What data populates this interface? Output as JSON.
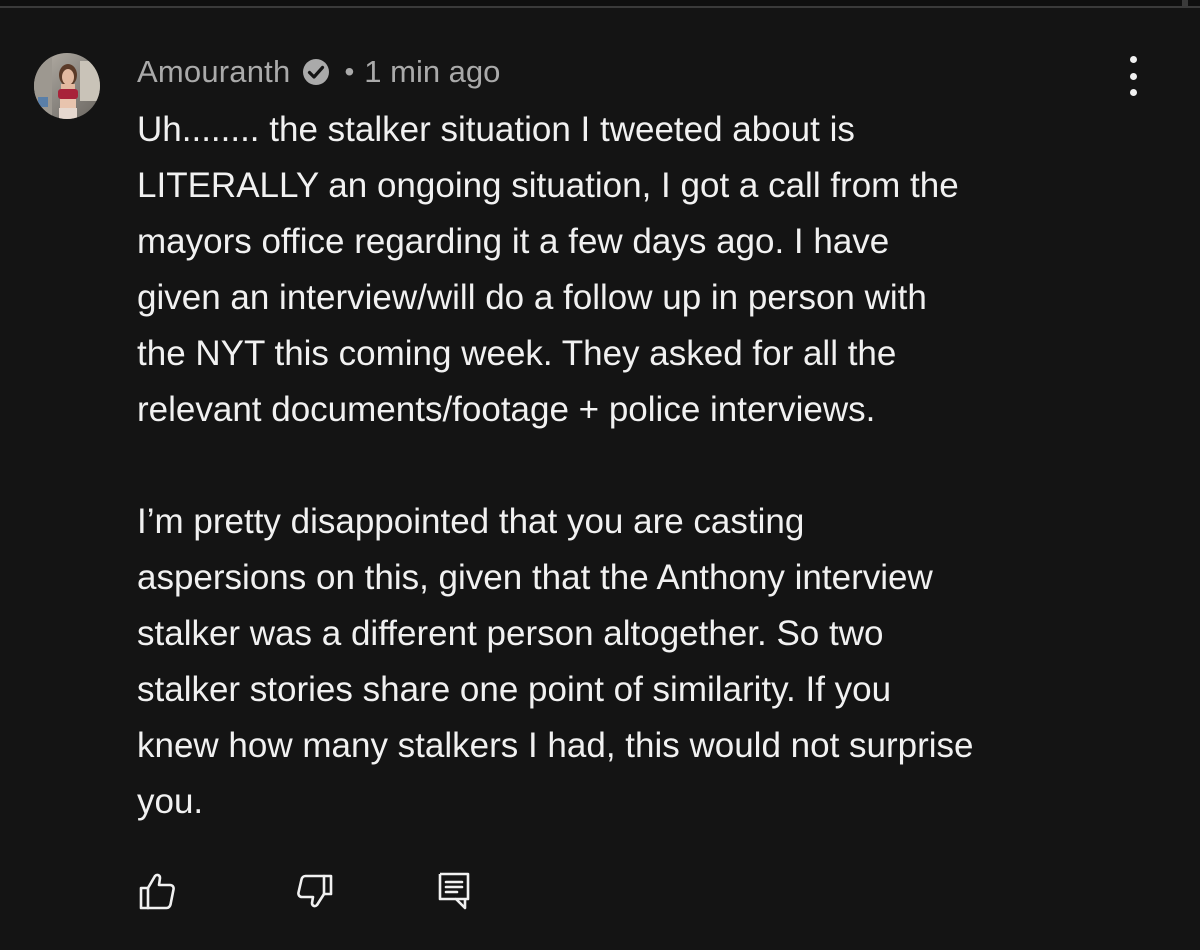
{
  "comment": {
    "author": "Amouranth",
    "separator": "•",
    "timestamp": "1 min ago",
    "verified_icon": "verified-check-icon",
    "paragraphs": [
      {
        "lines": [
          "Uh........  the stalker situation I tweeted about is",
          "LITERALLY an ongoing situation, I got a call from the",
          "mayors office regarding it a few days ago.  I have",
          "given an interview/will do a follow up in person with",
          "the NYT this coming week.  They asked for all the",
          "relevant documents/footage + police interviews."
        ]
      },
      {
        "lines": [
          "I’m pretty disappointed that you are casting",
          "aspersions on this, given that the Anthony interview",
          "stalker was a different person altogether.  So two",
          "stalker stories share one point of similarity.  If you",
          "knew how many stalkers I had, this would not surprise",
          "you."
        ]
      }
    ]
  },
  "actions": {
    "like_icon": "thumbs-up-icon",
    "dislike_icon": "thumbs-down-icon",
    "reply_icon": "reply-comment-icon",
    "more_icon": "more-vertical-icon"
  },
  "colors": {
    "background": "#141414",
    "text_primary": "#f1f1f1",
    "text_secondary": "#aaaaaa"
  }
}
